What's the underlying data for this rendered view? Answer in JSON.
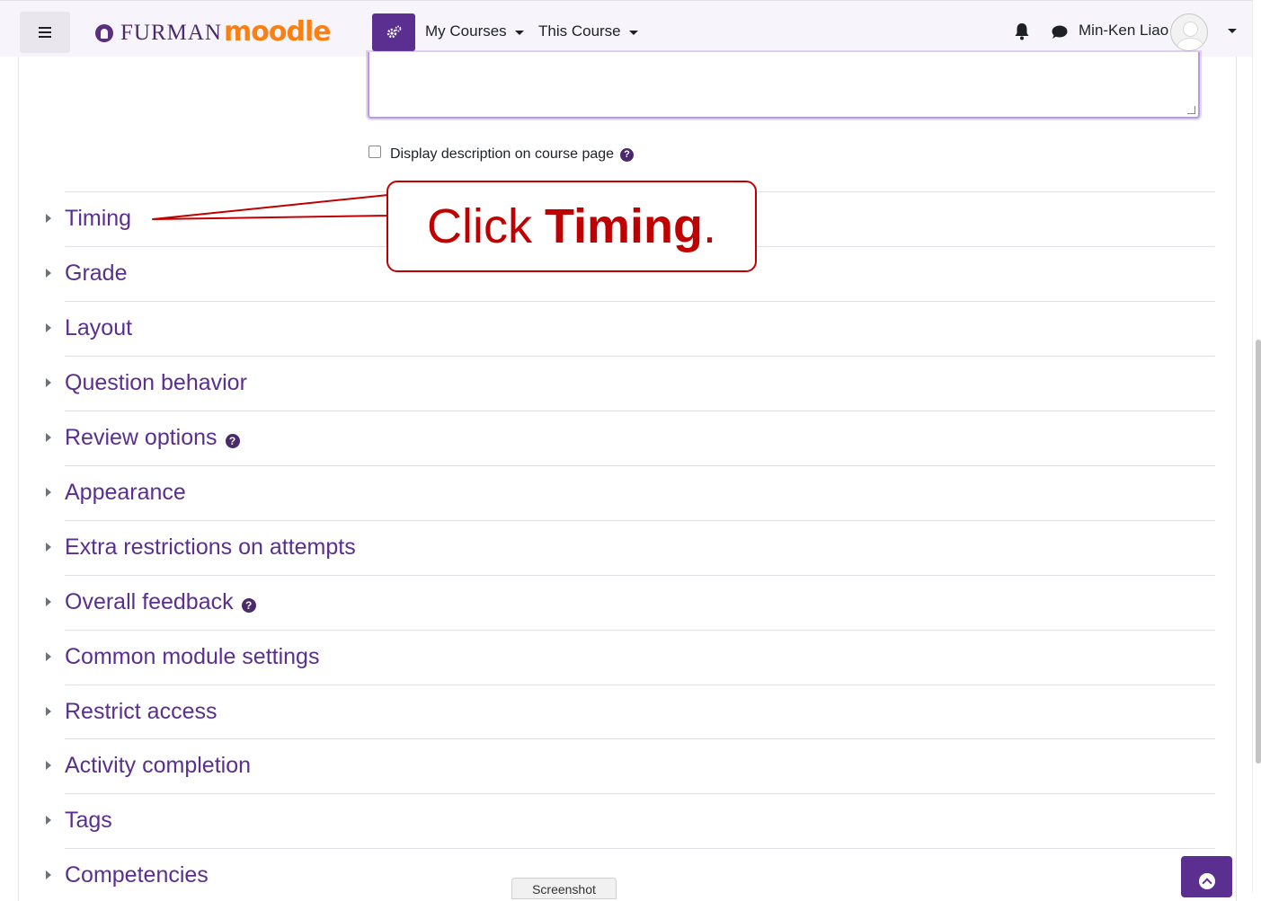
{
  "navbar": {
    "brand_university": "FURMAN",
    "brand_app": "moodle",
    "menus": [
      {
        "label": "My Courses"
      },
      {
        "label": "This Course"
      }
    ],
    "user_name": "Min-Ken Liao",
    "icons": [
      "menu-icon",
      "admin-gear-icon",
      "bell-icon",
      "chat-icon",
      "user-avatar",
      "chevron-down-icon"
    ],
    "accent_color": "#5a2f8f"
  },
  "form": {
    "display_description_label": "Display description on course page",
    "sections": [
      {
        "label": "Timing"
      },
      {
        "label": "Grade"
      },
      {
        "label": "Layout"
      },
      {
        "label": "Question behavior"
      },
      {
        "label": "Review options"
      },
      {
        "label": "Appearance"
      },
      {
        "label": "Extra restrictions on attempts"
      },
      {
        "label": "Overall feedback"
      },
      {
        "label": "Common module settings"
      },
      {
        "label": "Restrict access"
      },
      {
        "label": "Activity completion"
      },
      {
        "label": "Tags"
      },
      {
        "label": "Competencies"
      }
    ]
  },
  "callout": {
    "prefix": "Click",
    "bold": "Timing",
    "suffix": ".",
    "color": "#c00000"
  },
  "footer": {
    "screenshot_tab": "Screenshot"
  }
}
